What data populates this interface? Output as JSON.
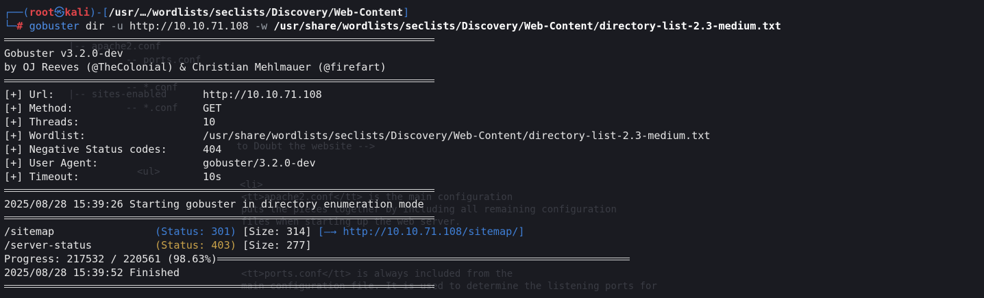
{
  "prompt": {
    "frame_open": "┌──(",
    "user": "root",
    "skull": "㉿",
    "host": "kali",
    "frame_mid": ")-[",
    "cwd": "/usr/…/wordlists/seclists/Discovery/Web-Content",
    "frame_close": "]",
    "frame_bottom": "└─",
    "hash": "#",
    "command": "gobuster",
    "subcommand": "dir",
    "flag_u": "-u",
    "url_arg": "http://10.10.71.108",
    "flag_w": "-w",
    "wordlist_arg": "/usr/share/wordlists/seclists/Discovery/Web-Content/directory-list-2.3-medium.txt"
  },
  "banner": {
    "version": "Gobuster v3.2.0-dev",
    "authors": "by OJ Reeves (@TheColonial) & Christian Mehlmauer (@firefart)"
  },
  "config": [
    {
      "label": "[+] Url:",
      "value": "http://10.10.71.108"
    },
    {
      "label": "[+] Method:",
      "value": "GET"
    },
    {
      "label": "[+] Threads:",
      "value": "10"
    },
    {
      "label": "[+] Wordlist:",
      "value": "/usr/share/wordlists/seclists/Discovery/Web-Content/directory-list-2.3-medium.txt"
    },
    {
      "label": "[+] Negative Status codes:",
      "value": "404"
    },
    {
      "label": "[+] User Agent:",
      "value": "gobuster/3.2.0-dev"
    },
    {
      "label": "[+] Timeout:",
      "value": "10s"
    }
  ],
  "start_message": "2025/08/28 15:39:26 Starting gobuster in directory enumeration mode",
  "results": [
    {
      "path": "/sitemap",
      "status": "(Status: 301)",
      "size": "[Size: 314]",
      "redirect": "[—→ http://10.10.71.108/sitemap/]"
    },
    {
      "path": "/server-status",
      "status": "(Status: 403)",
      "size": "[Size: 277]",
      "redirect": ""
    }
  ],
  "progress": "Progress: 217532 / 220561 (98.63%)",
  "progress_fraction": 0.9863,
  "finish_message": "2025/08/28 15:39:52 Finished",
  "colors": {
    "background": "#1a1b21",
    "prompt_frame": "#3f7fd6",
    "root_user": "#e0454a",
    "status_301": "#3f7fd6",
    "status_403": "#c9a24a"
  },
  "ghost_text": [
    "|-- apache2.conf",
    "    -- ports.conf",
    "    -- *.conf",
    "|-- sites-enabled",
    "    -- *.conf",
    "to Doubt the website -->",
    "<ul>",
    "<li>",
    "<tt>apache2.conf</tt> is the main configuration",
    "puts the pieces together by including all remaining configuration",
    "files when starting up the web server.",
    "<tt>ports.conf</tt> is always included from the",
    "main configuration file. It is used to determine the listening ports for"
  ]
}
